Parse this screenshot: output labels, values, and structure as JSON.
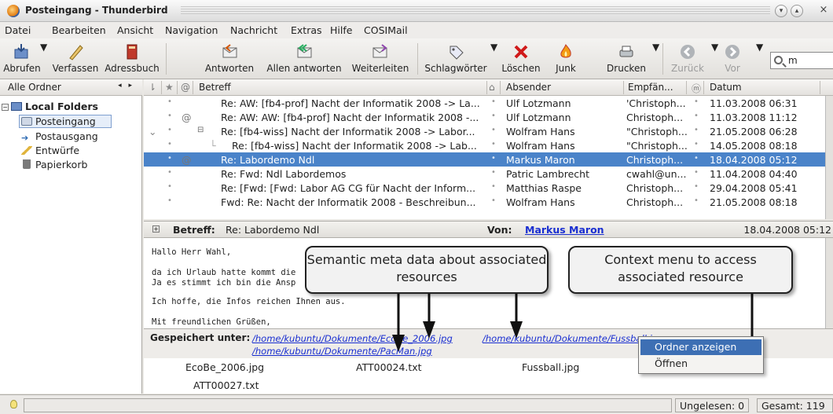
{
  "window": {
    "title": "Posteingang - Thunderbird",
    "close_glyph": "×"
  },
  "menubar": [
    "Datei",
    "Bearbeiten",
    "Ansicht",
    "Navigation",
    "Nachricht",
    "Extras",
    "Hilfe",
    "COSIMail"
  ],
  "toolbar": {
    "buttons": [
      "Abrufen",
      "Verfassen",
      "Adressbuch",
      "Antworten",
      "Allen antworten",
      "Weiterleiten",
      "Schlagwörter",
      "Löschen",
      "Junk",
      "Drucken",
      "Zurück",
      "Vor"
    ],
    "search_value": "m"
  },
  "folders": {
    "header": "Alle Ordner",
    "nav_glyph": "◂ ▸",
    "account": "Local Folders",
    "items": [
      "Posteingang",
      "Postausgang",
      "Entwürfe",
      "Papierkorb"
    ],
    "selected": "Posteingang"
  },
  "threads": {
    "columns": {
      "subject": "Betreff",
      "sender": "Absender",
      "recipient": "Empfän...",
      "date": "Datum"
    },
    "rows": [
      {
        "subject": "Re: AW: [fb4-prof] Nacht der Informatik 2008 -> La...",
        "sender": "Ulf Lotzmann",
        "recipient": "'Christoph...",
        "date": "11.03.2008 06:31",
        "attach": false,
        "indent": 0
      },
      {
        "subject": "Re: AW: AW: [fb4-prof] Nacht der Informatik 2008 -...",
        "sender": "Ulf Lotzmann",
        "recipient": "Christoph...",
        "date": "11.03.2008 11:12",
        "attach": true,
        "indent": 0
      },
      {
        "subject": "Re: [fb4-wiss] Nacht der Informatik 2008 -> Labor...",
        "sender": "Wolfram Hans",
        "recipient": "\"Christoph...",
        "date": "21.05.2008 06:28",
        "attach": false,
        "indent": 0
      },
      {
        "subject": "Re: [fb4-wiss] Nacht der Informatik 2008 -> Lab...",
        "sender": "Wolfram Hans",
        "recipient": "\"Christoph...",
        "date": "14.05.2008 08:18",
        "attach": false,
        "indent": 1
      },
      {
        "subject": "Re: Labordemo Ndl",
        "sender": "Markus Maron",
        "recipient": "Christoph...",
        "date": "18.04.2008 05:12",
        "attach": true,
        "indent": 0
      },
      {
        "subject": "Re: Fwd: Ndl Labordemos",
        "sender": "Patric Lambrecht",
        "recipient": "cwahl@un...",
        "date": "11.04.2008 04:40",
        "attach": false,
        "indent": 0
      },
      {
        "subject": "Re: [Fwd: [Fwd: Labor AG CG für Nacht der Inform...",
        "sender": "Matthias Raspe",
        "recipient": "Christoph...",
        "date": "29.04.2008 05:41",
        "attach": false,
        "indent": 0
      },
      {
        "subject": "Fwd: Re: Nacht der Informatik 2008 - Beschreibun...",
        "sender": "Wolfram Hans",
        "recipient": "Christoph...",
        "date": "21.05.2008 08:18",
        "attach": false,
        "indent": 0
      }
    ],
    "selected_index": 4
  },
  "message": {
    "subject_label": "Betreff:",
    "subject": "Re: Labordemo Ndl",
    "from_label": "Von:",
    "from": "Markus Maron",
    "date": "18.04.2008 05:12",
    "body_lines": [
      "Hallo Herr Wahl,",
      "da ich Urlaub hatte kommt die",
      "Ja es stimmt ich bin die Ansp",
      "Ich hoffe, die Infos reichen Ihnen aus.",
      "Mit freundlichen Grüßen,"
    ]
  },
  "saved": {
    "label": "Gespeichert unter:",
    "paths": [
      "/home/kubuntu/Dokumente/EcoBe_2006.jpg",
      "/home/kubuntu/Dokumente/Fussball.jpg",
      "/home/kubuntu/Dokumente/PacMan.jpg"
    ]
  },
  "attachments": [
    "EcoBe_2006.jpg",
    "ATT00024.txt",
    "Fussball.jpg",
    "ATT00027.txt"
  ],
  "context_menu": [
    "Ordner anzeigen",
    "Öffnen"
  ],
  "callouts": {
    "meta": "Semantic meta data about associated resources",
    "context": "Context menu to access associated resource"
  },
  "status": {
    "unread": "Ungelesen: 0",
    "total": "Gesamt: 119"
  },
  "colors": {
    "selection": "#4a83c9",
    "link": "#1a2fd1",
    "menu_highlight": "#3d6fb4"
  }
}
